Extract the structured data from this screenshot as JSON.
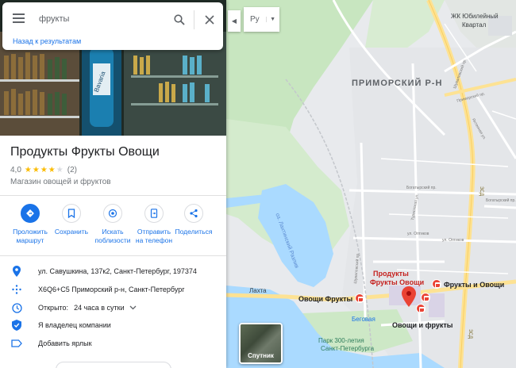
{
  "search": {
    "query": "фрукты",
    "back_label": "Назад к результатам"
  },
  "place": {
    "title": "Продукты Фрукты Овощи",
    "rating": "4,0",
    "stars_filled": 4,
    "stars_total": 5,
    "stars_text": "★★★★",
    "stars_empty_text": "★",
    "review_count": "(2)",
    "category": "Магазин овощей и фруктов"
  },
  "actions": [
    {
      "label_1": "Проложить",
      "label_2": "маршрут",
      "icon": "directions-icon"
    },
    {
      "label_1": "Сохранить",
      "label_2": "",
      "icon": "bookmark-icon"
    },
    {
      "label_1": "Искать",
      "label_2": "поблизости",
      "icon": "nearby-icon"
    },
    {
      "label_1": "Отправить",
      "label_2": "на телефон",
      "icon": "send-to-phone-icon"
    },
    {
      "label_1": "Поделиться",
      "label_2": "",
      "icon": "share-icon"
    }
  ],
  "info": {
    "address": "ул. Савушкина, 137к2, Санкт-Петербург, 197374",
    "plus_code": "X6Q6+C5 Приморский р-н, Санкт-Петербург",
    "hours_label": "Открыто:",
    "hours_value": "24 часа в сутки",
    "owner": "Я владелец компании",
    "add_label": "Добавить ярлык"
  },
  "map_controls": {
    "language": "Ру",
    "satellite_label": "Спутник"
  },
  "map_labels": {
    "district": "ПРИМОРСКИЙ Р-Н",
    "jk_1": "ЖК Юбилейный",
    "jk_2": "Квартал",
    "lakhta": "Лахта",
    "lake": "оз. Лахтинский Разлив",
    "begovaya": "Беговая",
    "park_1": "Парк 300-летия",
    "park_2": "Санкт-Петербурга",
    "zsd_1": "ЗСД",
    "zsd_2": "ЗСД",
    "poi_main_1": "Продукты",
    "poi_main_2": "Фрукты Овощи",
    "poi_fo": "Фрукты и Овощи",
    "poi_of": "Овощи Фрукты",
    "poi_oif": "Овощи и фрукты",
    "street_1": "Богатырский пр.",
    "street_2": "Богатырский пр.",
    "street_3": "ул. Оптиков",
    "street_4": "ул. Оптиков",
    "street_5": "Туристская ул.",
    "street_6": "Шуваловский пр.",
    "street_7": "Шуваловский пр.",
    "street_8": "Яхтенная ул.",
    "street_9": "Приморский пр."
  },
  "colors": {
    "accent": "#1a73e8",
    "pin": "#ea4335",
    "water": "#aadaff",
    "park": "#c8e6c0",
    "road_major": "#fde293",
    "road_minor": "#ffffff",
    "star": "#fbbc04"
  }
}
